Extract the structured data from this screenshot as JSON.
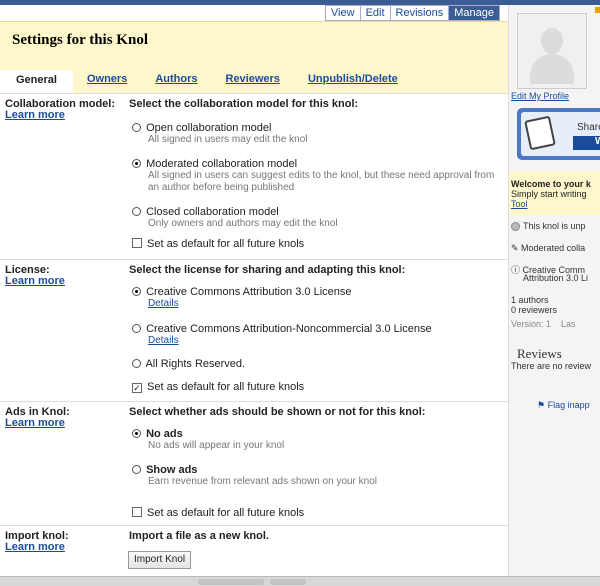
{
  "view_tabs": [
    "View",
    "Edit",
    "Revisions",
    "Manage"
  ],
  "title": "Settings for this Knol",
  "tabs": [
    "General",
    "Owners",
    "Authors",
    "Reviewers",
    "Unpublish/Delete"
  ],
  "learn_more": "Learn more",
  "collab": {
    "label": "Collaboration model:",
    "heading": "Select the collaboration model for this knol:",
    "options": [
      {
        "title": "Open collaboration model",
        "desc": "All signed in users may edit the knol"
      },
      {
        "title": "Moderated collaboration model",
        "desc": "All signed in users can suggest edits to the knol, but these need approval from an author before being published"
      },
      {
        "title": "Closed collaboration model",
        "desc": "Only owners and authors may edit the knol"
      }
    ],
    "default": "Set as default for all future knols"
  },
  "license": {
    "label": "License:",
    "heading": "Select the license for sharing and adapting this knol:",
    "options": [
      {
        "title": "Creative Commons Attribution 3.0 License",
        "details": "Details"
      },
      {
        "title": "Creative Commons Attribution-Noncommercial 3.0 License",
        "details": "Details"
      },
      {
        "title": "All Rights Reserved."
      }
    ],
    "default": "Set as default for all future knols"
  },
  "ads": {
    "label": "Ads in Knol:",
    "heading": "Select whether ads should be shown or not for this knol:",
    "options": [
      {
        "title": "No ads",
        "desc": "No ads will appear in your knol"
      },
      {
        "title": "Show ads",
        "desc": "Earn revenue from relevant ads shown on your knol"
      }
    ],
    "default": "Set as default for all future knols"
  },
  "import": {
    "label": "Import knol:",
    "heading": "Import a file as a new knol.",
    "button": "Import Knol"
  },
  "sidebar": {
    "edit_profile": "Edit My Profile",
    "share_text": "Share",
    "w_button": "W",
    "welcome_title": "Welcome to your k",
    "welcome_text": "Simply start writing",
    "welcome_link": "Tool",
    "status": "This knol is unp",
    "moderated": "Moderated colla",
    "cc_line1": "Creative Comm",
    "cc_line2": "Attribution 3.0 Li",
    "authors": "1 authors",
    "reviewers": "0 reviewers",
    "version": "Version: 1",
    "last": "Las",
    "reviews_title": "Reviews",
    "no_reviews": "There are no review",
    "flag": "Flag inapp"
  }
}
